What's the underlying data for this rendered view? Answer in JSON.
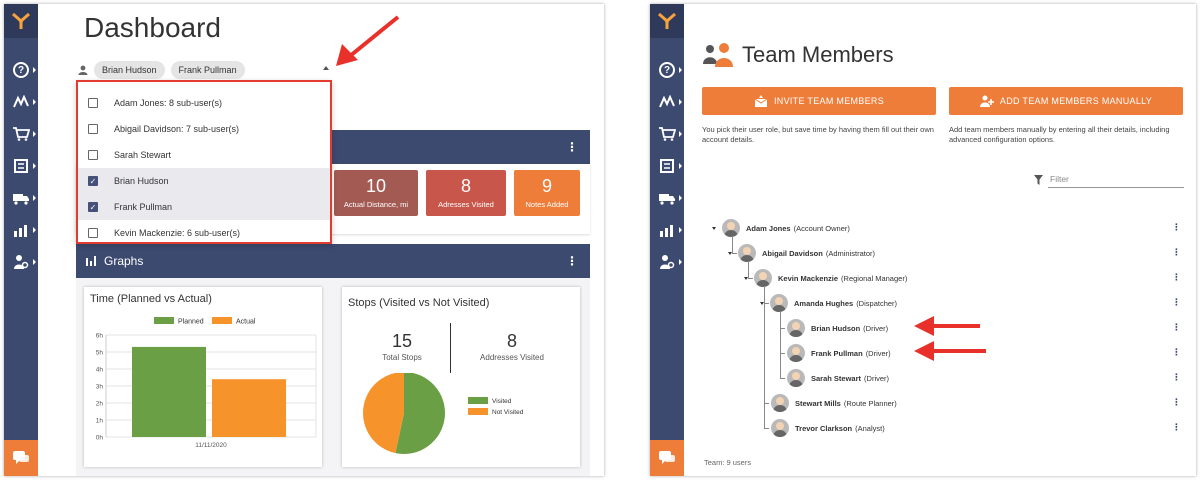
{
  "left": {
    "title": "Dashboard",
    "selected_chips": [
      "Brian Hudson",
      "Frank Pullman"
    ],
    "dropdown": [
      {
        "label": "Adam Jones: 8 sub-user(s)",
        "checked": false
      },
      {
        "label": "Abigail Davidson: 7 sub-user(s)",
        "checked": false
      },
      {
        "label": "Sarah Stewart",
        "checked": false
      },
      {
        "label": "Brian Hudson",
        "checked": true
      },
      {
        "label": "Frank Pullman",
        "checked": true
      },
      {
        "label": "Kevin Mackenzie: 6 sub-user(s)",
        "checked": false
      }
    ],
    "stats": [
      {
        "value": "10",
        "label": "Actual Distance, mi",
        "color": "#a35a52"
      },
      {
        "value": "8",
        "label": "Adresses Visited",
        "color": "#c8564a"
      },
      {
        "value": "9",
        "label": "Notes Added",
        "color": "#ef7d3a"
      }
    ],
    "graphs_label": "Graphs",
    "time_chart": {
      "title": "Time (Planned vs Actual)",
      "legend": [
        "Planned",
        "Actual"
      ],
      "y_ticks": [
        "6h",
        "5h",
        "4h",
        "3h",
        "2h",
        "1h",
        "0h"
      ],
      "x_label": "11/11/2020"
    },
    "stops": {
      "title": "Stops (Visited vs Not Visited)",
      "total_value": "15",
      "total_label": "Total Stops",
      "visited_value": "8",
      "visited_label": "Addresses Visited",
      "legend": [
        "Visited",
        "Not Visited"
      ]
    }
  },
  "chart_data": [
    {
      "type": "bar",
      "title": "Time (Planned vs Actual)",
      "categories": [
        "11/11/2020"
      ],
      "series": [
        {
          "name": "Planned",
          "values": [
            5.3
          ],
          "color": "#6a9f45"
        },
        {
          "name": "Actual",
          "values": [
            3.4
          ],
          "color": "#f7932b"
        }
      ],
      "ylim": [
        0,
        6
      ],
      "y_unit": "h",
      "grid": true,
      "legend": "top"
    },
    {
      "type": "pie",
      "title": "Stops (Visited vs Not Visited)",
      "labels": [
        "Visited",
        "Not Visited"
      ],
      "values": [
        8,
        7
      ],
      "colors": [
        "#6a9f45",
        "#f7932b"
      ],
      "legend": "right"
    }
  ],
  "right": {
    "title": "Team Members",
    "invite_label": "INVITE TEAM MEMBERS",
    "invite_desc": "You pick their user role, but save time by having them fill out their own account details.",
    "add_label": "ADD TEAM MEMBERS MANUALLY",
    "add_desc": "Add team members manually by entering all their details, including advanced configuration options.",
    "filter_placeholder": "Filter",
    "members": [
      {
        "name": "Adam Jones",
        "role": "(Account Owner)",
        "level": 0,
        "toggle": true
      },
      {
        "name": "Abigail Davidson",
        "role": "(Administrator)",
        "level": 1,
        "toggle": true
      },
      {
        "name": "Kevin Mackenzie",
        "role": "(Regional Manager)",
        "level": 2,
        "toggle": true
      },
      {
        "name": "Amanda Hughes",
        "role": "(Dispatcher)",
        "level": 3,
        "toggle": true
      },
      {
        "name": "Brian Hudson",
        "role": "(Driver)",
        "level": 4,
        "toggle": false
      },
      {
        "name": "Frank Pullman",
        "role": "(Driver)",
        "level": 4,
        "toggle": false
      },
      {
        "name": "Sarah Stewart",
        "role": "(Driver)",
        "level": 4,
        "toggle": false
      },
      {
        "name": "Stewart Mills",
        "role": "(Route Planner)",
        "level": 3,
        "toggle": false
      },
      {
        "name": "Trevor Clarkson",
        "role": "(Analyst)",
        "level": 3,
        "toggle": false
      }
    ],
    "team_count": "Team: 9 users"
  }
}
